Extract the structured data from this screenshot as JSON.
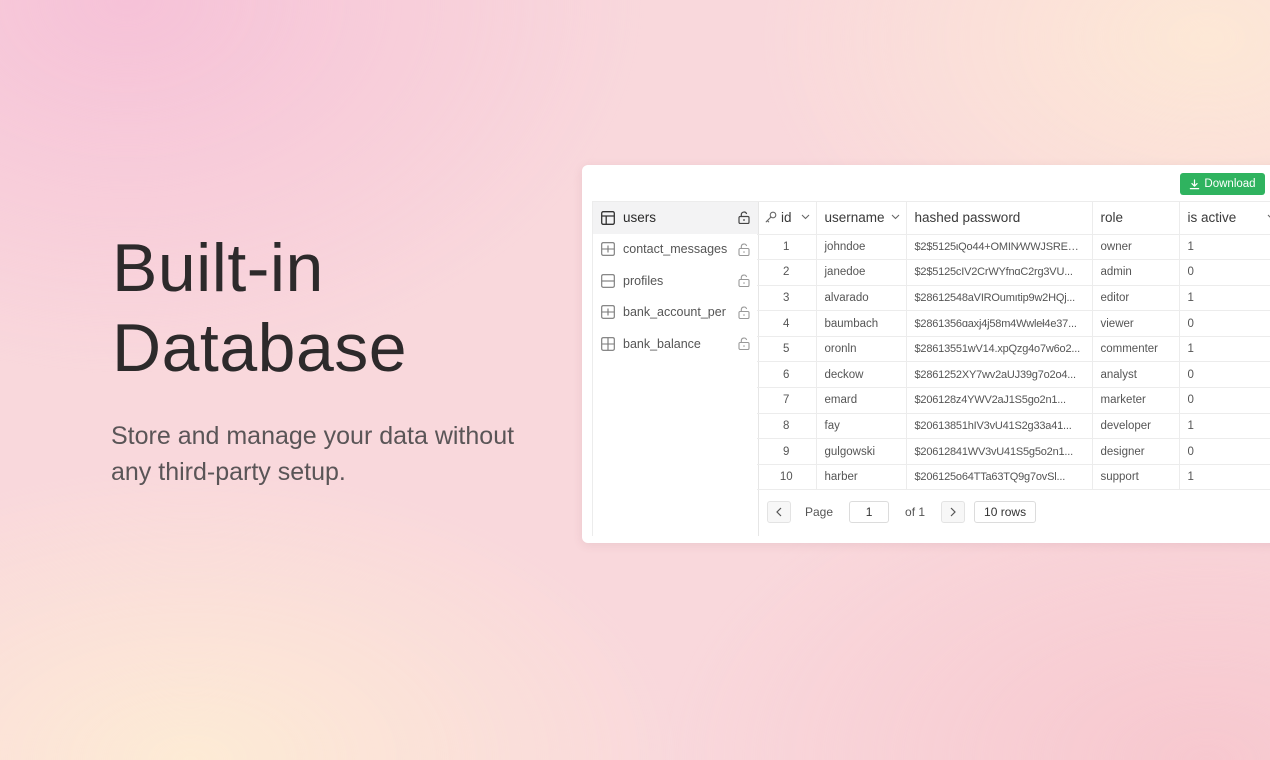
{
  "hero": {
    "title": "Built-in Database",
    "subtitle": "Store and manage your data without any third-party setup."
  },
  "toolbar": {
    "download_label": "Download",
    "download_icon": "download-icon",
    "accent_color": "#2fb35f"
  },
  "sidebar": {
    "tables": [
      {
        "label": "users",
        "active": true
      },
      {
        "label": "contact_messages",
        "active": false
      },
      {
        "label": "profiles",
        "active": false
      },
      {
        "label": "bank_account_per",
        "active": false
      },
      {
        "label": "bank_balance",
        "active": false
      }
    ]
  },
  "table": {
    "columns": [
      "id",
      "username",
      "hashed password",
      "role",
      "is active"
    ],
    "rows": [
      {
        "id": "1",
        "username": "johndoe",
        "password": "$2$5125ιQo44+OMIN⁄WWJSREHg...",
        "role": "owner",
        "is_active": "1"
      },
      {
        "id": "2",
        "username": "janedoe",
        "password": "$2$5125cIV2CrWYfnɑC2rg3VU...",
        "role": "admin",
        "is_active": "0"
      },
      {
        "id": "3",
        "username": "alvarado",
        "password": "$28612548aVIROumıtip9w2HQj...",
        "role": "editor",
        "is_active": "1"
      },
      {
        "id": "4",
        "username": "baumbach",
        "password": "$2861356ɑaxj4j58m4Wwleł4e37...",
        "role": "viewer",
        "is_active": "0"
      },
      {
        "id": "5",
        "username": "oronln",
        "password": "$28613551wV14.xpQzg4o7w6o2...",
        "role": "commenter",
        "is_active": "1"
      },
      {
        "id": "6",
        "username": "deckow",
        "password": "$2861252XY7wv2aUJ39g7o2o4...",
        "role": "analyst",
        "is_active": "0"
      },
      {
        "id": "7",
        "username": "emard",
        "password": "$206128z4YWV2aJ1S5go2n1...",
        "role": "marketer",
        "is_active": "0"
      },
      {
        "id": "8",
        "username": "fay",
        "password": "$20613851hIV3vU41S2g33a41...",
        "role": "developer",
        "is_active": "1"
      },
      {
        "id": "9",
        "username": "gulgowski",
        "password": "$20612841WV3vU41S5g5o2n1...",
        "role": "designer",
        "is_active": "0"
      },
      {
        "id": "10",
        "username": "harber",
        "password": "$206125o64TTa63TQ9g7ovSl...",
        "role": "support",
        "is_active": "1"
      }
    ]
  },
  "pagination": {
    "page_label": "Page",
    "page_value": "1",
    "of_label": "of 1",
    "rows_label": "10 rows"
  }
}
